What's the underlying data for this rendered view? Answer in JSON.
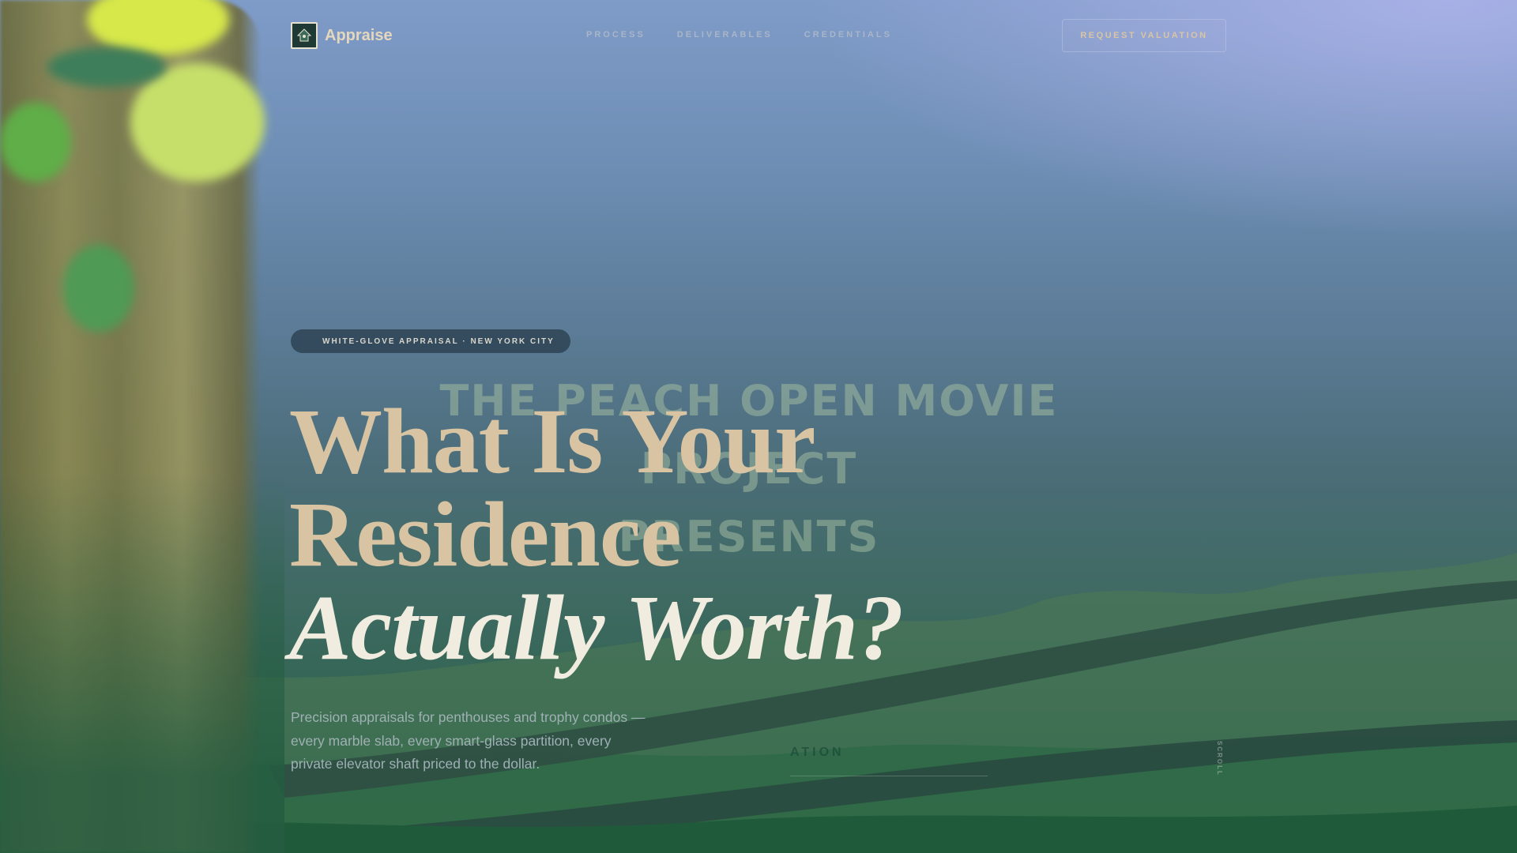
{
  "nav": {
    "brand": "Appraise",
    "links": [
      "PROCESS",
      "DELIVERABLES",
      "CREDENTIALS"
    ],
    "cta": "REQUEST VALUATION"
  },
  "hero": {
    "badge": "WHITE-GLOVE APPRAISAL · NEW YORK CITY",
    "headline_line1": "What Is Your",
    "headline_line2": "Residence",
    "headline_line3": "Actually Worth?",
    "subtext": "Precision appraisals for penthouses and trophy condos — every marble slab, every smart-glass partition, every private elevator shaft priced to the dollar.",
    "scroll_label": "SCROLL"
  },
  "background_video": {
    "title_card_line1": "THE PEACH OPEN MOVIE PROJECT",
    "title_card_line2": "PRESENTS",
    "ghost_cta": "ATION"
  },
  "colors": {
    "accent_gold": "#d8c4a2",
    "headline_light": "#f1ece0",
    "badge_bg": "#2c3d4b"
  }
}
